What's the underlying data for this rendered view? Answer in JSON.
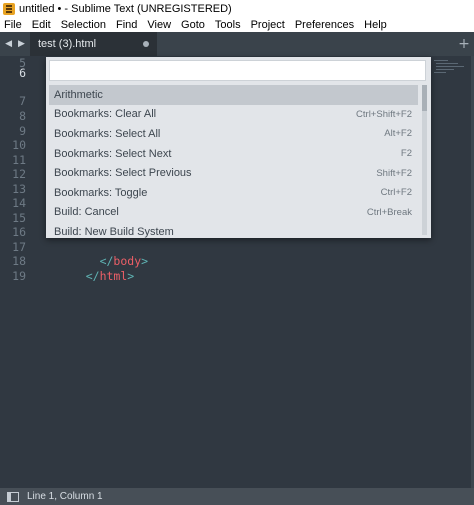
{
  "window": {
    "title": "untitled • - Sublime Text (UNREGISTERED)"
  },
  "menu": [
    "File",
    "Edit",
    "Selection",
    "Find",
    "View",
    "Goto",
    "Tools",
    "Project",
    "Preferences",
    "Help"
  ],
  "tabs": [
    {
      "label": "test (3).html",
      "dirty": true
    }
  ],
  "editor": {
    "line_numbers": [
      "5",
      "6",
      "7",
      "8",
      "9",
      "10",
      "11",
      "12",
      "13",
      "14",
      "15",
      "16",
      "17",
      "18",
      "19"
    ],
    "current_line": "6",
    "code": [
      {
        "line": "17",
        "indent": "  ",
        "open": "</",
        "tag": "body",
        "close": ">"
      },
      {
        "line": "18",
        "indent": "",
        "open": "</",
        "tag": "html",
        "close": ">"
      }
    ]
  },
  "palette": {
    "query": "",
    "items": [
      {
        "label": "Arithmetic",
        "shortcut": "",
        "selected": true
      },
      {
        "label": "Bookmarks: Clear All",
        "shortcut": "Ctrl+Shift+F2"
      },
      {
        "label": "Bookmarks: Select All",
        "shortcut": "Alt+F2"
      },
      {
        "label": "Bookmarks: Select Next",
        "shortcut": "F2"
      },
      {
        "label": "Bookmarks: Select Previous",
        "shortcut": "Shift+F2"
      },
      {
        "label": "Bookmarks: Toggle",
        "shortcut": "Ctrl+F2"
      },
      {
        "label": "Build: Cancel",
        "shortcut": "Ctrl+Break"
      },
      {
        "label": "Build: New Build System",
        "shortcut": ""
      }
    ]
  },
  "status": {
    "position": "Line 1, Column 1"
  }
}
